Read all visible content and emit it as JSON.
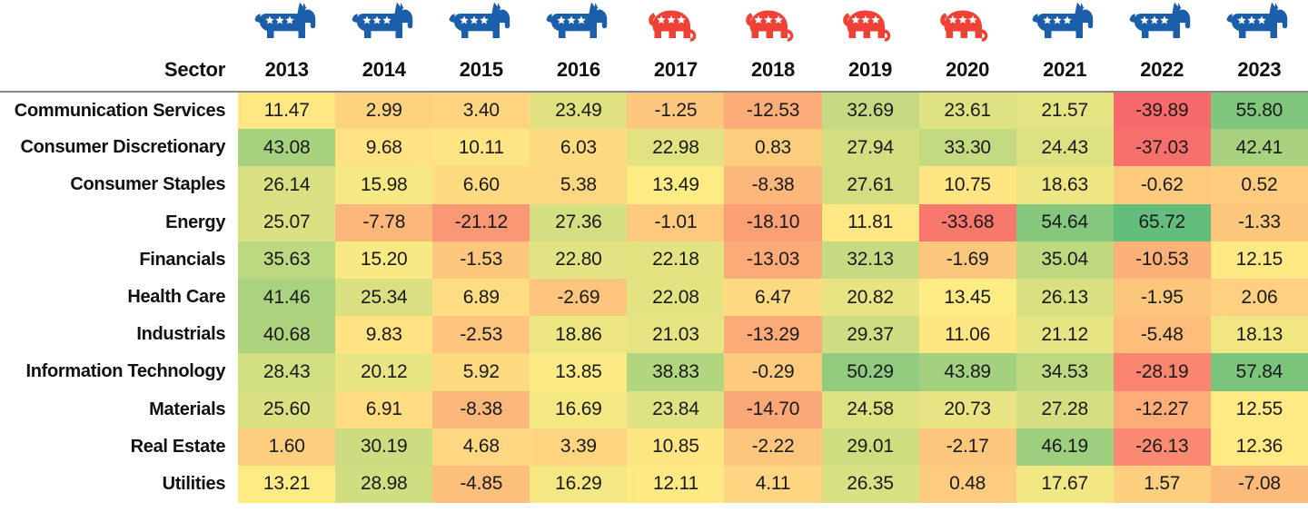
{
  "header": {
    "sector_label": "Sector",
    "years": [
      "2013",
      "2014",
      "2015",
      "2016",
      "2017",
      "2018",
      "2019",
      "2020",
      "2021",
      "2022",
      "2023"
    ],
    "party_icons": [
      "donkey-icon",
      "donkey-icon",
      "donkey-icon",
      "donkey-icon",
      "elephant-icon",
      "elephant-icon",
      "elephant-icon",
      "elephant-icon",
      "donkey-icon",
      "donkey-icon",
      "donkey-icon"
    ]
  },
  "colors": {
    "democrat_blue": "#1b5faa",
    "republican_red": "#ef4136",
    "scale_low": "#f8696b",
    "scale_mid": "#ffeb84",
    "scale_high": "#63be7b",
    "rule": "#8a8a8a",
    "text": "#111111"
  },
  "chart_data": {
    "type": "heatmap",
    "title": "",
    "xlabel": "",
    "ylabel": "Sector",
    "x": [
      "2013",
      "2014",
      "2015",
      "2016",
      "2017",
      "2018",
      "2019",
      "2020",
      "2021",
      "2022",
      "2023"
    ],
    "y": [
      "Communication Services",
      "Consumer Discretionary",
      "Consumer Staples",
      "Energy",
      "Financials",
      "Health Care",
      "Industrials",
      "Information Technology",
      "Materials",
      "Real Estate",
      "Utilities"
    ],
    "colorscale": "red-yellow-green diverging",
    "zmin": -39.89,
    "zmax": 65.72,
    "values": [
      [
        11.47,
        2.99,
        3.4,
        23.49,
        -1.25,
        -12.53,
        32.69,
        23.61,
        21.57,
        -39.89,
        55.8
      ],
      [
        43.08,
        9.68,
        10.11,
        6.03,
        22.98,
        0.83,
        27.94,
        33.3,
        24.43,
        -37.03,
        42.41
      ],
      [
        26.14,
        15.98,
        6.6,
        5.38,
        13.49,
        -8.38,
        27.61,
        10.75,
        18.63,
        -0.62,
        0.52
      ],
      [
        25.07,
        -7.78,
        -21.12,
        27.36,
        -1.01,
        -18.1,
        11.81,
        -33.68,
        54.64,
        65.72,
        -1.33
      ],
      [
        35.63,
        15.2,
        -1.53,
        22.8,
        22.18,
        -13.03,
        32.13,
        -1.69,
        35.04,
        -10.53,
        12.15
      ],
      [
        41.46,
        25.34,
        6.89,
        -2.69,
        22.08,
        6.47,
        20.82,
        13.45,
        26.13,
        -1.95,
        2.06
      ],
      [
        40.68,
        9.83,
        -2.53,
        18.86,
        21.03,
        -13.29,
        29.37,
        11.06,
        21.12,
        -5.48,
        18.13
      ],
      [
        28.43,
        20.12,
        5.92,
        13.85,
        38.83,
        -0.29,
        50.29,
        43.89,
        34.53,
        -28.19,
        57.84
      ],
      [
        25.6,
        6.91,
        -8.38,
        16.69,
        23.84,
        -14.7,
        24.58,
        20.73,
        27.28,
        -12.27,
        12.55
      ],
      [
        1.6,
        30.19,
        4.68,
        3.39,
        10.85,
        -2.22,
        29.01,
        -2.17,
        46.19,
        -26.13,
        12.36
      ],
      [
        13.21,
        28.98,
        -4.85,
        16.29,
        12.11,
        4.11,
        26.35,
        0.48,
        17.67,
        1.57,
        -7.08
      ]
    ],
    "text": [
      [
        "11.47",
        "2.99",
        "3.40",
        "23.49",
        "-1.25",
        "-12.53",
        "32.69",
        "23.61",
        "21.57",
        "-39.89",
        "55.80"
      ],
      [
        "43.08",
        "9.68",
        "10.11",
        "6.03",
        "22.98",
        "0.83",
        "27.94",
        "33.30",
        "24.43",
        "-37.03",
        "42.41"
      ],
      [
        "26.14",
        "15.98",
        "6.60",
        "5.38",
        "13.49",
        "-8.38",
        "27.61",
        "10.75",
        "18.63",
        "-0.62",
        "0.52"
      ],
      [
        "25.07",
        "-7.78",
        "-21.12",
        "27.36",
        "-1.01",
        "-18.10",
        "11.81",
        "-33.68",
        "54.64",
        "65.72",
        "-1.33"
      ],
      [
        "35.63",
        "15.20",
        "-1.53",
        "22.80",
        "22.18",
        "-13.03",
        "32.13",
        "-1.69",
        "35.04",
        "-10.53",
        "12.15"
      ],
      [
        "41.46",
        "25.34",
        "6.89",
        "-2.69",
        "22.08",
        "6.47",
        "20.82",
        "13.45",
        "26.13",
        "-1.95",
        "2.06"
      ],
      [
        "40.68",
        "9.83",
        "-2.53",
        "18.86",
        "21.03",
        "-13.29",
        "29.37",
        "11.06",
        "21.12",
        "-5.48",
        "18.13"
      ],
      [
        "28.43",
        "20.12",
        "5.92",
        "13.85",
        "38.83",
        "-0.29",
        "50.29",
        "43.89",
        "34.53",
        "-28.19",
        "57.84"
      ],
      [
        "25.60",
        "6.91",
        "-8.38",
        "16.69",
        "23.84",
        "-14.70",
        "24.58",
        "20.73",
        "27.28",
        "-12.27",
        "12.55"
      ],
      [
        "1.60",
        "30.19",
        "4.68",
        "3.39",
        "10.85",
        "-2.22",
        "29.01",
        "-2.17",
        "46.19",
        "-26.13",
        "12.36"
      ],
      [
        "13.21",
        "28.98",
        "-4.85",
        "16.29",
        "12.11",
        "4.11",
        "26.35",
        "0.48",
        "17.67",
        "1.57",
        "-7.08"
      ]
    ]
  }
}
